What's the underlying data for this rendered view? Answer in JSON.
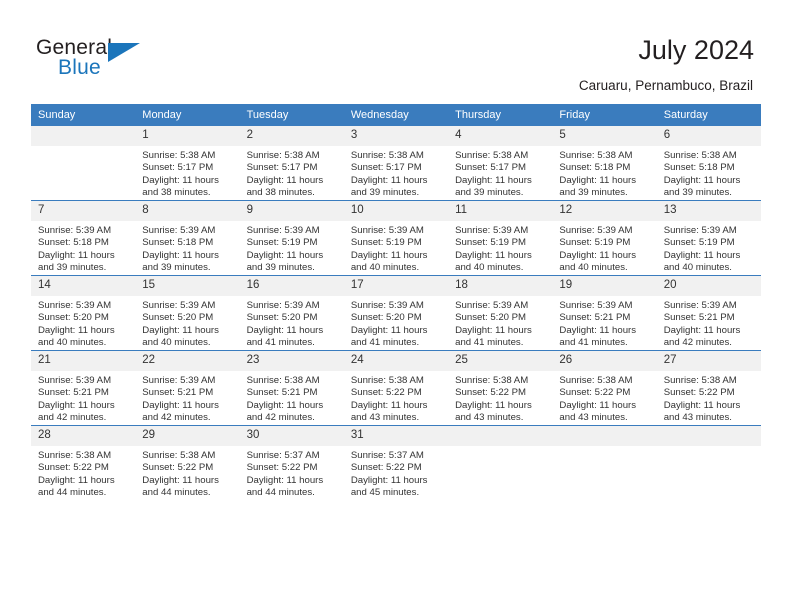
{
  "brand": {
    "name_dark": "General",
    "name_blue": "Blue",
    "accent_color": "#1b75bb"
  },
  "header": {
    "title": "July 2024",
    "subtitle": "Caruaru, Pernambuco, Brazil"
  },
  "calendar": {
    "header_bg": "#3a7cbe",
    "daynum_bg": "#f1f1f1",
    "weekdays": [
      "Sunday",
      "Monday",
      "Tuesday",
      "Wednesday",
      "Thursday",
      "Friday",
      "Saturday"
    ],
    "weeks": [
      [
        {
          "day": "",
          "empty": true,
          "sunrise": "",
          "sunset": "",
          "daylight1": "",
          "daylight2": ""
        },
        {
          "day": "1",
          "sunrise": "Sunrise: 5:38 AM",
          "sunset": "Sunset: 5:17 PM",
          "daylight1": "Daylight: 11 hours",
          "daylight2": "and 38 minutes."
        },
        {
          "day": "2",
          "sunrise": "Sunrise: 5:38 AM",
          "sunset": "Sunset: 5:17 PM",
          "daylight1": "Daylight: 11 hours",
          "daylight2": "and 38 minutes."
        },
        {
          "day": "3",
          "sunrise": "Sunrise: 5:38 AM",
          "sunset": "Sunset: 5:17 PM",
          "daylight1": "Daylight: 11 hours",
          "daylight2": "and 39 minutes."
        },
        {
          "day": "4",
          "sunrise": "Sunrise: 5:38 AM",
          "sunset": "Sunset: 5:17 PM",
          "daylight1": "Daylight: 11 hours",
          "daylight2": "and 39 minutes."
        },
        {
          "day": "5",
          "sunrise": "Sunrise: 5:38 AM",
          "sunset": "Sunset: 5:18 PM",
          "daylight1": "Daylight: 11 hours",
          "daylight2": "and 39 minutes."
        },
        {
          "day": "6",
          "sunrise": "Sunrise: 5:38 AM",
          "sunset": "Sunset: 5:18 PM",
          "daylight1": "Daylight: 11 hours",
          "daylight2": "and 39 minutes."
        }
      ],
      [
        {
          "day": "7",
          "sunrise": "Sunrise: 5:39 AM",
          "sunset": "Sunset: 5:18 PM",
          "daylight1": "Daylight: 11 hours",
          "daylight2": "and 39 minutes."
        },
        {
          "day": "8",
          "sunrise": "Sunrise: 5:39 AM",
          "sunset": "Sunset: 5:18 PM",
          "daylight1": "Daylight: 11 hours",
          "daylight2": "and 39 minutes."
        },
        {
          "day": "9",
          "sunrise": "Sunrise: 5:39 AM",
          "sunset": "Sunset: 5:19 PM",
          "daylight1": "Daylight: 11 hours",
          "daylight2": "and 39 minutes."
        },
        {
          "day": "10",
          "sunrise": "Sunrise: 5:39 AM",
          "sunset": "Sunset: 5:19 PM",
          "daylight1": "Daylight: 11 hours",
          "daylight2": "and 40 minutes."
        },
        {
          "day": "11",
          "sunrise": "Sunrise: 5:39 AM",
          "sunset": "Sunset: 5:19 PM",
          "daylight1": "Daylight: 11 hours",
          "daylight2": "and 40 minutes."
        },
        {
          "day": "12",
          "sunrise": "Sunrise: 5:39 AM",
          "sunset": "Sunset: 5:19 PM",
          "daylight1": "Daylight: 11 hours",
          "daylight2": "and 40 minutes."
        },
        {
          "day": "13",
          "sunrise": "Sunrise: 5:39 AM",
          "sunset": "Sunset: 5:19 PM",
          "daylight1": "Daylight: 11 hours",
          "daylight2": "and 40 minutes."
        }
      ],
      [
        {
          "day": "14",
          "sunrise": "Sunrise: 5:39 AM",
          "sunset": "Sunset: 5:20 PM",
          "daylight1": "Daylight: 11 hours",
          "daylight2": "and 40 minutes."
        },
        {
          "day": "15",
          "sunrise": "Sunrise: 5:39 AM",
          "sunset": "Sunset: 5:20 PM",
          "daylight1": "Daylight: 11 hours",
          "daylight2": "and 40 minutes."
        },
        {
          "day": "16",
          "sunrise": "Sunrise: 5:39 AM",
          "sunset": "Sunset: 5:20 PM",
          "daylight1": "Daylight: 11 hours",
          "daylight2": "and 41 minutes."
        },
        {
          "day": "17",
          "sunrise": "Sunrise: 5:39 AM",
          "sunset": "Sunset: 5:20 PM",
          "daylight1": "Daylight: 11 hours",
          "daylight2": "and 41 minutes."
        },
        {
          "day": "18",
          "sunrise": "Sunrise: 5:39 AM",
          "sunset": "Sunset: 5:20 PM",
          "daylight1": "Daylight: 11 hours",
          "daylight2": "and 41 minutes."
        },
        {
          "day": "19",
          "sunrise": "Sunrise: 5:39 AM",
          "sunset": "Sunset: 5:21 PM",
          "daylight1": "Daylight: 11 hours",
          "daylight2": "and 41 minutes."
        },
        {
          "day": "20",
          "sunrise": "Sunrise: 5:39 AM",
          "sunset": "Sunset: 5:21 PM",
          "daylight1": "Daylight: 11 hours",
          "daylight2": "and 42 minutes."
        }
      ],
      [
        {
          "day": "21",
          "sunrise": "Sunrise: 5:39 AM",
          "sunset": "Sunset: 5:21 PM",
          "daylight1": "Daylight: 11 hours",
          "daylight2": "and 42 minutes."
        },
        {
          "day": "22",
          "sunrise": "Sunrise: 5:39 AM",
          "sunset": "Sunset: 5:21 PM",
          "daylight1": "Daylight: 11 hours",
          "daylight2": "and 42 minutes."
        },
        {
          "day": "23",
          "sunrise": "Sunrise: 5:38 AM",
          "sunset": "Sunset: 5:21 PM",
          "daylight1": "Daylight: 11 hours",
          "daylight2": "and 42 minutes."
        },
        {
          "day": "24",
          "sunrise": "Sunrise: 5:38 AM",
          "sunset": "Sunset: 5:22 PM",
          "daylight1": "Daylight: 11 hours",
          "daylight2": "and 43 minutes."
        },
        {
          "day": "25",
          "sunrise": "Sunrise: 5:38 AM",
          "sunset": "Sunset: 5:22 PM",
          "daylight1": "Daylight: 11 hours",
          "daylight2": "and 43 minutes."
        },
        {
          "day": "26",
          "sunrise": "Sunrise: 5:38 AM",
          "sunset": "Sunset: 5:22 PM",
          "daylight1": "Daylight: 11 hours",
          "daylight2": "and 43 minutes."
        },
        {
          "day": "27",
          "sunrise": "Sunrise: 5:38 AM",
          "sunset": "Sunset: 5:22 PM",
          "daylight1": "Daylight: 11 hours",
          "daylight2": "and 43 minutes."
        }
      ],
      [
        {
          "day": "28",
          "sunrise": "Sunrise: 5:38 AM",
          "sunset": "Sunset: 5:22 PM",
          "daylight1": "Daylight: 11 hours",
          "daylight2": "and 44 minutes."
        },
        {
          "day": "29",
          "sunrise": "Sunrise: 5:38 AM",
          "sunset": "Sunset: 5:22 PM",
          "daylight1": "Daylight: 11 hours",
          "daylight2": "and 44 minutes."
        },
        {
          "day": "30",
          "sunrise": "Sunrise: 5:37 AM",
          "sunset": "Sunset: 5:22 PM",
          "daylight1": "Daylight: 11 hours",
          "daylight2": "and 44 minutes."
        },
        {
          "day": "31",
          "sunrise": "Sunrise: 5:37 AM",
          "sunset": "Sunset: 5:22 PM",
          "daylight1": "Daylight: 11 hours",
          "daylight2": "and 45 minutes."
        },
        {
          "day": "",
          "empty": true,
          "sunrise": "",
          "sunset": "",
          "daylight1": "",
          "daylight2": ""
        },
        {
          "day": "",
          "empty": true,
          "sunrise": "",
          "sunset": "",
          "daylight1": "",
          "daylight2": ""
        },
        {
          "day": "",
          "empty": true,
          "sunrise": "",
          "sunset": "",
          "daylight1": "",
          "daylight2": ""
        }
      ]
    ]
  }
}
